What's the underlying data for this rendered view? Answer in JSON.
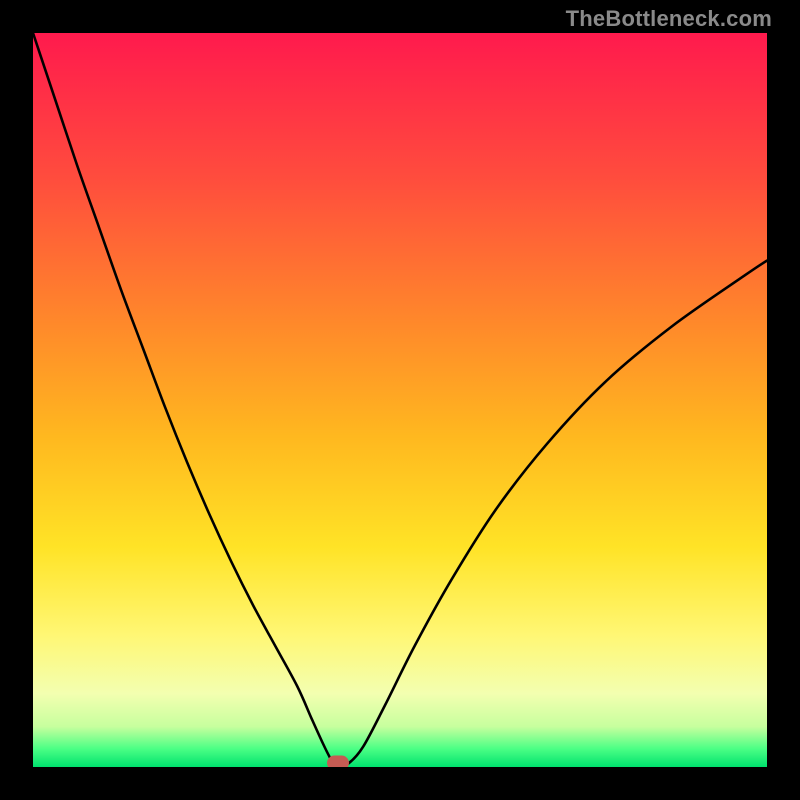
{
  "watermark": "TheBottleneck.com",
  "colors": {
    "frame": "#000000",
    "curve": "#000000",
    "marker": "#c55b53",
    "gradient_stops": [
      {
        "pos": 0.0,
        "color": "#ff1a4d"
      },
      {
        "pos": 0.2,
        "color": "#ff4d3d"
      },
      {
        "pos": 0.4,
        "color": "#ff8a2a"
      },
      {
        "pos": 0.55,
        "color": "#ffb81f"
      },
      {
        "pos": 0.7,
        "color": "#ffe326"
      },
      {
        "pos": 0.82,
        "color": "#fff774"
      },
      {
        "pos": 0.9,
        "color": "#f3ffb0"
      },
      {
        "pos": 0.945,
        "color": "#c7ff9e"
      },
      {
        "pos": 0.975,
        "color": "#4cff85"
      },
      {
        "pos": 1.0,
        "color": "#00e26e"
      }
    ]
  },
  "chart_data": {
    "type": "line",
    "title": "",
    "xlabel": "",
    "ylabel": "",
    "xlim": [
      0,
      100
    ],
    "ylim": [
      0,
      100
    ],
    "series": [
      {
        "name": "bottleneck-curve",
        "x": [
          0,
          3,
          6,
          9,
          12,
          15,
          18,
          21,
          24,
          27,
          30,
          33,
          36,
          38,
          39.5,
          40.5,
          41,
          42,
          43,
          45,
          48,
          52,
          57,
          63,
          70,
          78,
          87,
          97,
          100
        ],
        "y": [
          100,
          91,
          82,
          73.5,
          65,
          57,
          49,
          41.5,
          34.5,
          28,
          22,
          16.5,
          11,
          6.5,
          3.2,
          1.2,
          0.5,
          0.5,
          0.5,
          2.8,
          8.5,
          16.5,
          25.5,
          35,
          44,
          52.5,
          60,
          67,
          69
        ]
      }
    ],
    "annotations": [
      {
        "name": "optimal-point",
        "x": 41.5,
        "y": 0.5
      }
    ],
    "legend": false,
    "grid": false
  }
}
